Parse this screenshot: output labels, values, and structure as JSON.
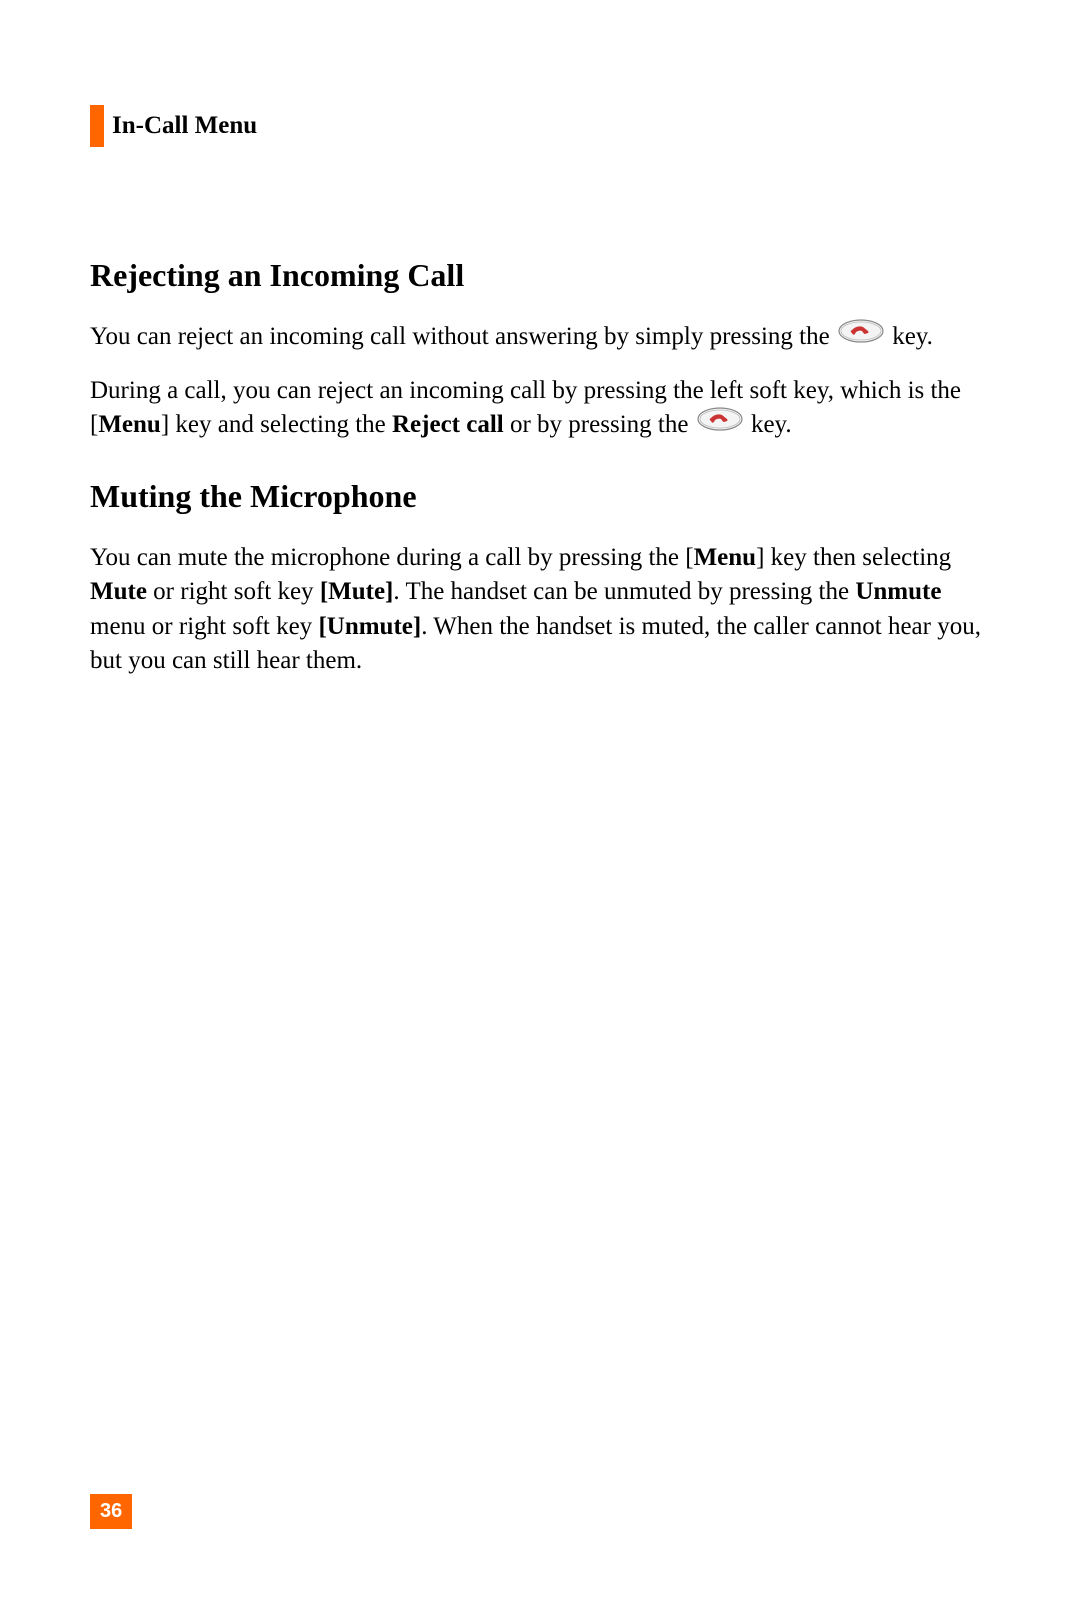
{
  "header": {
    "section_title": "In-Call Menu"
  },
  "content": {
    "h1": "Rejecting an Incoming Call",
    "p1a": "You can reject an incoming call without answering by simply pressing the ",
    "p1b": " key.",
    "p2a": "During a call, you can reject an incoming call by pressing the left soft key, which is the [",
    "p2b": "Menu",
    "p2c": "] key and selecting the ",
    "p2d": "Reject call",
    "p2e": " or by pressing the ",
    "p2f": " key.",
    "h2": "Muting the Microphone",
    "p3a": "You can mute the microphone during a call by pressing the [",
    "p3b": "Menu",
    "p3c": "] key then selecting ",
    "p3d": "Mute",
    "p3e": " or right soft key ",
    "p3f": "[Mute]",
    "p3g": ". The handset can be unmuted by pressing the ",
    "p3h": "Unmute",
    "p3i": " menu or right soft key ",
    "p3j": "[Unmute]",
    "p3k": ". When the handset is muted, the caller cannot hear you, but you can still hear them."
  },
  "footer": {
    "page_number": "36"
  }
}
